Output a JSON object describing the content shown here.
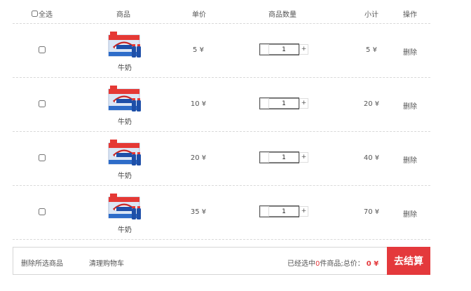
{
  "header": {
    "select_all": "全选",
    "goods": "商品",
    "price": "单价",
    "quantity": "商品数量",
    "subtotal": "小计",
    "operation": "操作"
  },
  "items": [
    {
      "name": "牛奶",
      "price": "5 ¥",
      "qty": "1",
      "subtotal": "5 ¥",
      "delete": "删除"
    },
    {
      "name": "牛奶",
      "price": "10 ¥",
      "qty": "1",
      "subtotal": "20 ¥",
      "delete": "删除"
    },
    {
      "name": "牛奶",
      "price": "20 ¥",
      "qty": "1",
      "subtotal": "40 ¥",
      "delete": "删除"
    },
    {
      "name": "牛奶",
      "price": "35 ¥",
      "qty": "1",
      "subtotal": "70 ¥",
      "delete": "删除"
    }
  ],
  "qty_controls": {
    "minus": "",
    "plus": "+"
  },
  "footer": {
    "delete_selected": "删除所选商品",
    "clear_cart": "清理购物车",
    "summary_prefix": "已经选中",
    "selected_count": "0",
    "summary_suffix": "件商品;总价：",
    "total": "0 ¥",
    "checkout": "去结算"
  },
  "colors": {
    "accent": "#e4393c",
    "divider": "#d9d9d9"
  },
  "icons": {
    "product_image": "milk-box-icon"
  }
}
